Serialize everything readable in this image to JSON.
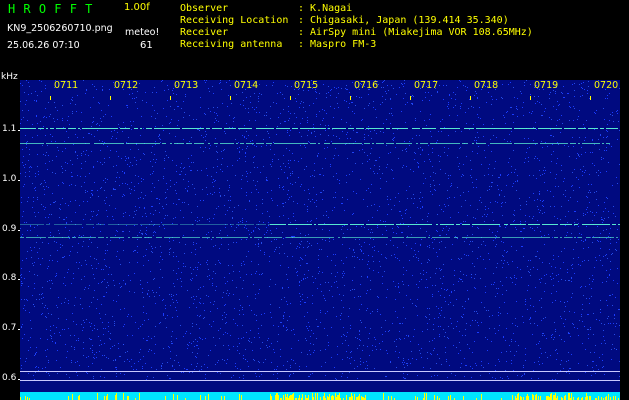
{
  "header": {
    "app_title": "HROFFT",
    "version": "1.00f",
    "file_name": "KN9_2506260710.png",
    "meteo_label": "meteo!",
    "datetime": "25.06.26 07:10",
    "count": "61"
  },
  "info": [
    {
      "label": "Observer",
      "value": ": K.Nagai"
    },
    {
      "label": "Receiving Location",
      "value": ": Chigasaki, Japan (139.414 35.340)"
    },
    {
      "label": "Receiver",
      "value": ": AirSpy mini (Miakejima VOR 108.65MHz)"
    },
    {
      "label": "Receiving antenna",
      "value": ": Maspro FM-3"
    }
  ],
  "spectrogram": {
    "unit_label": "kHz",
    "freq_ticks": [
      "1.1",
      "1.0",
      "0.9",
      "0.8",
      "0.7",
      "0.6"
    ],
    "time_ticks": [
      "0711",
      "0712",
      "0713",
      "0714",
      "0715",
      "0716",
      "0717",
      "0718",
      "0719",
      "0720"
    ],
    "colors": {
      "background": "#000a80",
      "noise": "#1a3cff",
      "signal": "#5fffd8",
      "floor": "#00e5ff",
      "spikes": "#ffff00",
      "hline": "#c8c8ff"
    }
  }
}
